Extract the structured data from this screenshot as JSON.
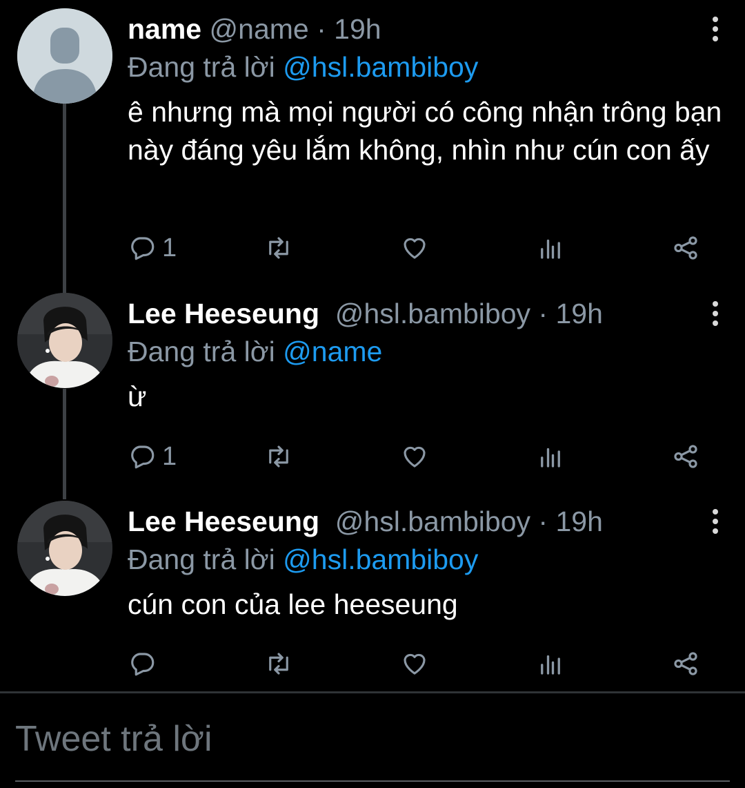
{
  "thread": [
    {
      "display_name": "name",
      "handle": "@name",
      "separator": "·",
      "time": "19h",
      "reply_label": "Đang trả lời",
      "reply_to": "@hsl.bambiboy",
      "text": "ê nhưng mà mọi người có công nhận trông bạn này đáng yêu lắm không, nhìn như cún con ấy",
      "reply_count": "1",
      "avatar": "default-avatar-icon"
    },
    {
      "display_name": "Lee Heeseung",
      "handle": "@hsl.bambiboy",
      "separator": "·",
      "time": "19h",
      "reply_label": "Đang trả lời",
      "reply_to": "@name",
      "text": "ừ",
      "reply_count": "1",
      "avatar": "profile-photo"
    },
    {
      "display_name": "Lee Heeseung",
      "handle": "@hsl.bambiboy",
      "separator": "·",
      "time": "19h",
      "reply_label": "Đang trả lời",
      "reply_to": "@hsl.bambiboy",
      "text": "cún con của lee heeseung",
      "reply_count": "",
      "avatar": "profile-photo"
    }
  ],
  "composer": {
    "placeholder": "Tweet trả lời"
  },
  "icons": [
    "reply-icon",
    "retweet-icon",
    "like-icon",
    "analytics-icon",
    "share-icon",
    "more-options-icon"
  ],
  "colors": {
    "background": "#000000",
    "accent": "#1d9bf0",
    "secondary_text": "#8b98a5",
    "thread_line": "#3d4145"
  }
}
